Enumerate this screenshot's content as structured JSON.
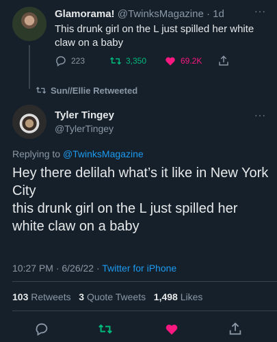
{
  "tweet1": {
    "display_name": "Glamorama!",
    "handle_time": "@TwinksMagazine · 1d",
    "text": "This drunk girl on the L just spilled her white claw on a baby",
    "replies": "223",
    "retweets": "3,350",
    "likes": "69.2K"
  },
  "retweet_note": "Sun//Ellie Retweeted",
  "tweet2": {
    "display_name": "Tyler Tingey",
    "handle": "@TylerTingey",
    "replying_prefix": "Replying to ",
    "replying_to": "@TwinksMagazine",
    "text_line1": "Hey there delilah what’s it like in New York City",
    "text_line2": "this drunk girl on the L just spilled her white claw on a baby",
    "time_date": "10:27 PM · 6/26/22 · ",
    "source": "Twitter for iPhone",
    "retweets_count": "103",
    "retweets_label": "Retweets",
    "quotes_count": "3",
    "quotes_label": "Quote Tweets",
    "likes_count": "1,498",
    "likes_label": "Likes"
  },
  "more_glyph": "···",
  "colors": {
    "background": "#15202b",
    "link": "#1d9bf0",
    "retweet": "#00ba7c",
    "like": "#f91880"
  }
}
